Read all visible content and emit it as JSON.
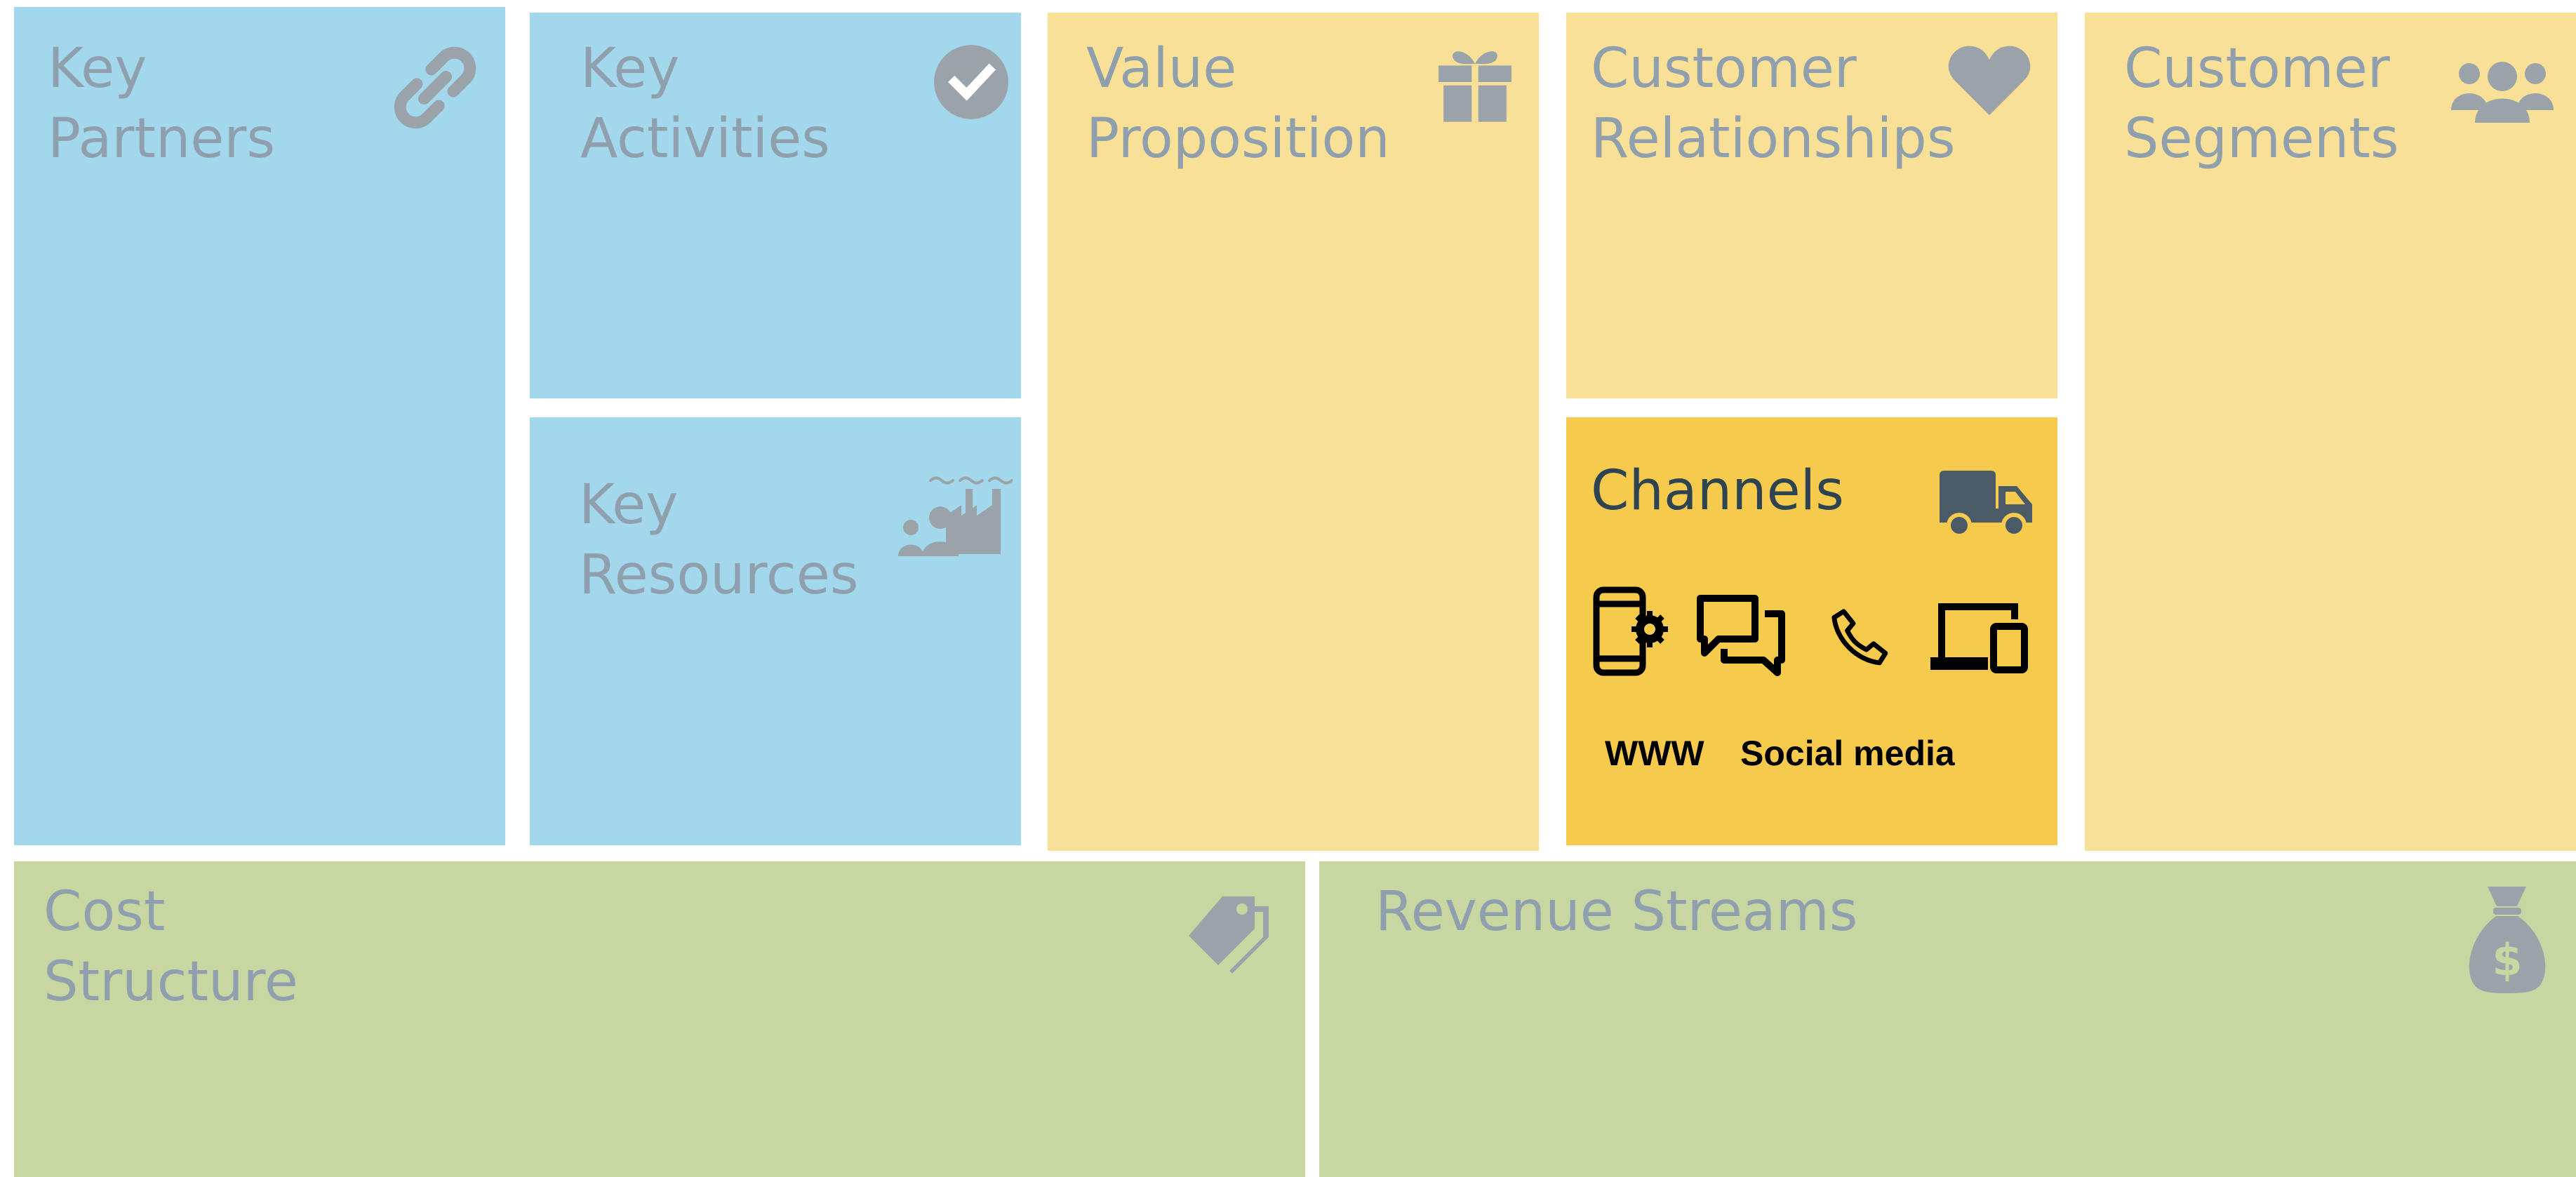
{
  "canvas": {
    "key_partners": {
      "title_line1": "Key",
      "title_line2": "Partners",
      "icon": "link-icon"
    },
    "key_activities": {
      "title_line1": "Key",
      "title_line2": "Activities",
      "icon": "check-circle-icon"
    },
    "key_resources": {
      "title_line1": "Key",
      "title_line2": "Resources",
      "icon": "factory-people-icon"
    },
    "value_proposition": {
      "title_line1": "Value",
      "title_line2": "Proposition",
      "icon": "gift-icon"
    },
    "customer_relationships": {
      "title_line1": "Customer",
      "title_line2": "Relationships",
      "icon": "heart-icon"
    },
    "channels": {
      "title": "Channels",
      "icon": "truck-icon",
      "channel_icons": [
        "mobile-settings-icon",
        "chat-bubbles-icon",
        "phone-icon",
        "devices-icon"
      ],
      "labels": [
        "WWW",
        "Social media"
      ]
    },
    "customer_segments": {
      "title_line1": "Customer",
      "title_line2": "Segments",
      "icon": "people-group-icon"
    },
    "cost_structure": {
      "title_line1": "Cost",
      "title_line2": "Structure",
      "icon": "price-tag-icon"
    },
    "revenue_streams": {
      "title": "Revenue Streams",
      "icon": "money-bag-icon"
    }
  },
  "colors": {
    "infrastructure_blue": "#a3d8ec",
    "offer_yellow": "#f8e197",
    "channels_highlight": "#f6cb4d",
    "finance_green": "#c8d7a2",
    "title_grey": "#8f9fad",
    "icon_grey": "#9ba3aa",
    "channels_title": "#2f4452"
  }
}
